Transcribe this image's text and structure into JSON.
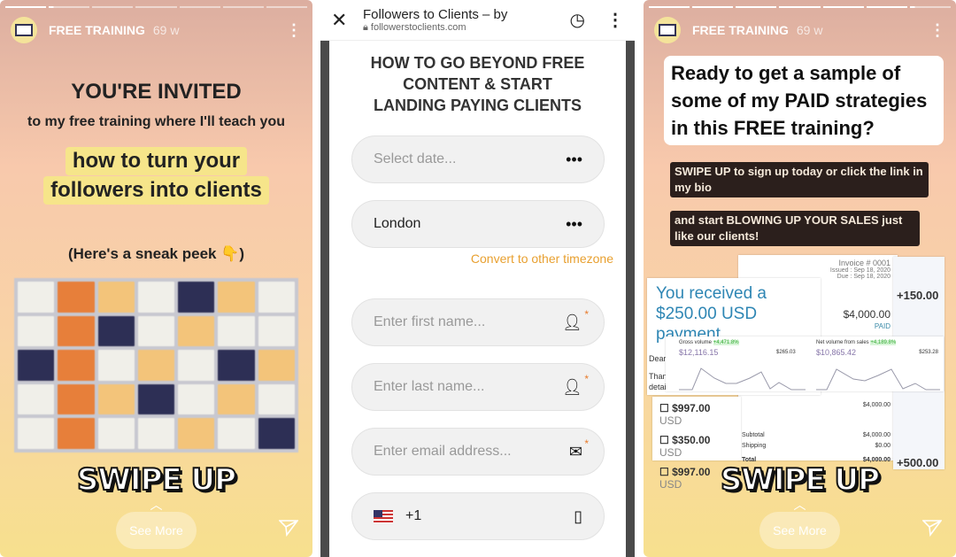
{
  "left_story": {
    "account": "FREE TRAINING",
    "age": "69 w",
    "heading": "YOU'RE INVITED",
    "line1": "to my free training where I'll teach you",
    "highlight1": "how to turn your",
    "highlight2": "followers into clients",
    "sneak": "(Here's a sneak peek 👇)",
    "swipe": "SWIPE UP",
    "see_more": "See More",
    "progress_active": 1
  },
  "browser": {
    "title": "Followers to Clients – by",
    "url": "followerstoclients.com",
    "headline": "HOW TO GO BEYOND FREE CONTENT & START LANDING PAYING CLIENTS",
    "date_placeholder": "Select date...",
    "timezone_value": "London",
    "timezone_link": "Convert to other timezone",
    "first_name_placeholder": "Enter first name...",
    "last_name_placeholder": "Enter last name...",
    "email_placeholder": "Enter email address...",
    "phone_code": "+1",
    "accent": "#e8a030"
  },
  "right_story": {
    "account": "FREE TRAINING",
    "age": "69 w",
    "question": "Ready to get a sample of some of my PAID strategies in this FREE training?",
    "cta1": "SWIPE UP to sign up today or click the link in my bio",
    "cta2": "and start BLOWING UP YOUR SALES just like our clients!",
    "received": "You received a $250.00 USD payment",
    "invoice_no": "Invoice # 0001",
    "issued": "Issued : Sep 18, 2020",
    "due": "Due : Sep 18, 2020",
    "invoice_amount": "$4,000.00",
    "paid": "PAID",
    "plus1": "+150.00",
    "plus2": "+500.00",
    "gross_label": "Gross volume",
    "gross_change": "+4,471.8%",
    "gross_value": "$12,116.15",
    "gross_side": "$265.03",
    "net_label": "Net volume from sales",
    "net_change": "+4,189.8%",
    "net_value": "$10,865.42",
    "net_side": "$253.28",
    "payments": [
      {
        "amount": "$997.00",
        "cur": "USD"
      },
      {
        "amount": "$350.00",
        "cur": "USD"
      },
      {
        "amount": "$997.00",
        "cur": "USD"
      }
    ],
    "line_total": "$4,000.00",
    "subtotal_label": "Subtotal",
    "subtotal": "$4,000.00",
    "shipping_label": "Shipping",
    "shipping": "$0.00",
    "total_label": "Total",
    "total": "$4,000.00",
    "dear": "Dear",
    "than": "Than",
    "detai": "detai",
    "swipe": "SWIPE UP",
    "see_more": "See More"
  }
}
